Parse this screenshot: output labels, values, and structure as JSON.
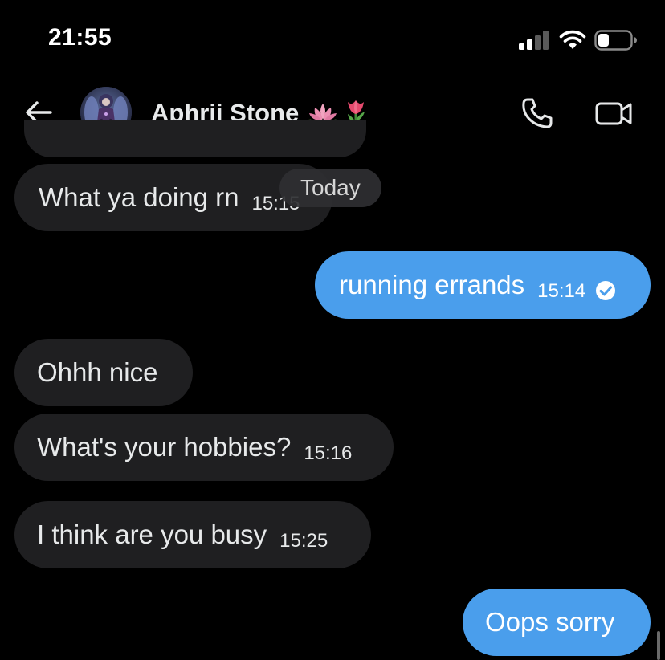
{
  "status_bar": {
    "time": "21:55"
  },
  "header": {
    "contact_name": "Aphrii Stone",
    "name_emojis": [
      "lotus-emoji",
      "tulip-emoji"
    ]
  },
  "date_separator": "Today",
  "messages": [
    {
      "direction": "incoming",
      "text": "What ya doing rn",
      "time": "15:15"
    },
    {
      "direction": "outgoing",
      "text": "running errands",
      "time": "15:14",
      "status": "read"
    },
    {
      "direction": "incoming",
      "text": "Ohhh nice",
      "time": ""
    },
    {
      "direction": "incoming",
      "text": "What's your hobbies?",
      "time": "15:16"
    },
    {
      "direction": "incoming",
      "text": "I think are you busy",
      "time": "15:25"
    },
    {
      "direction": "outgoing",
      "text": "Oops sorry",
      "time": ""
    }
  ],
  "colors": {
    "background": "#000000",
    "incoming_bubble": "#1f1f21",
    "outgoing_bubble": "#4a9eec",
    "text": "#e7e9ea"
  },
  "icons": {
    "back": "arrow-left-icon",
    "call": "phone-icon",
    "video": "video-camera-icon",
    "read": "check-circle-icon",
    "signal": "signal-icon",
    "wifi": "wifi-icon",
    "battery": "battery-icon"
  }
}
